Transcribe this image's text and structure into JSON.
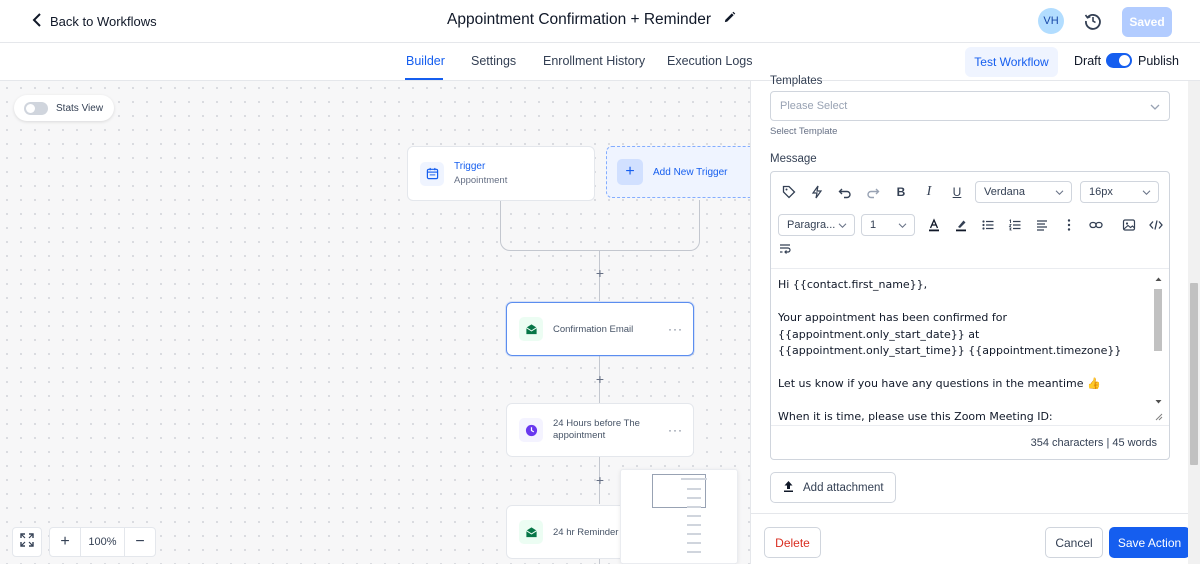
{
  "header": {
    "back_label": "Back to Workflows",
    "workflow_title": "Appointment Confirmation + Reminder",
    "avatar_initials": "VH",
    "saved_label": "Saved"
  },
  "tabs": [
    {
      "label": "Builder",
      "active": true
    },
    {
      "label": "Settings",
      "active": false
    },
    {
      "label": "Enrollment History",
      "active": false
    },
    {
      "label": "Execution Logs",
      "active": false
    }
  ],
  "actions": {
    "test_label": "Test Workflow",
    "draft_label": "Draft",
    "publish_label": "Publish",
    "published": true
  },
  "canvas": {
    "stats_label": "Stats View",
    "stats_enabled": false,
    "trigger": {
      "title": "Trigger",
      "subtitle": "Appointment"
    },
    "add_trigger_label": "Add New Trigger",
    "nodes": [
      {
        "label": "Confirmation Email",
        "icon": "email-icon",
        "selected": true
      },
      {
        "label": "24 Hours before The appointment",
        "icon": "clock-icon",
        "selected": false
      },
      {
        "label": "24 hr Reminder E",
        "icon": "email-icon",
        "selected": false
      }
    ],
    "zoom": "100%"
  },
  "panel": {
    "templates_label": "Templates",
    "select_placeholder": "Please Select",
    "select_hint": "Select Template",
    "message_label": "Message",
    "toolbar": {
      "font_family": "Verdana",
      "font_size": "16px",
      "block_format": "Paragra...",
      "line_height": "1"
    },
    "message_lines": [
      "Hi {{contact.first_name}},",
      "",
      "Your appointment has been confirmed for",
      "{{appointment.only_start_date}} at",
      "{{appointment.only_start_time}} {{appointment.timezone}}",
      "",
      "Let us know if you have any questions in the meantime 👍",
      "",
      "When it is time, please use this Zoom Meeting ID:"
    ],
    "counter": "354 characters | 45 words",
    "attach_label": "Add attachment",
    "delete_label": "Delete",
    "cancel_label": "Cancel",
    "save_label": "Save Action"
  },
  "colors": {
    "accent": "#155eef",
    "danger": "#d92d20",
    "saved_disabled": "#b2ccff"
  }
}
